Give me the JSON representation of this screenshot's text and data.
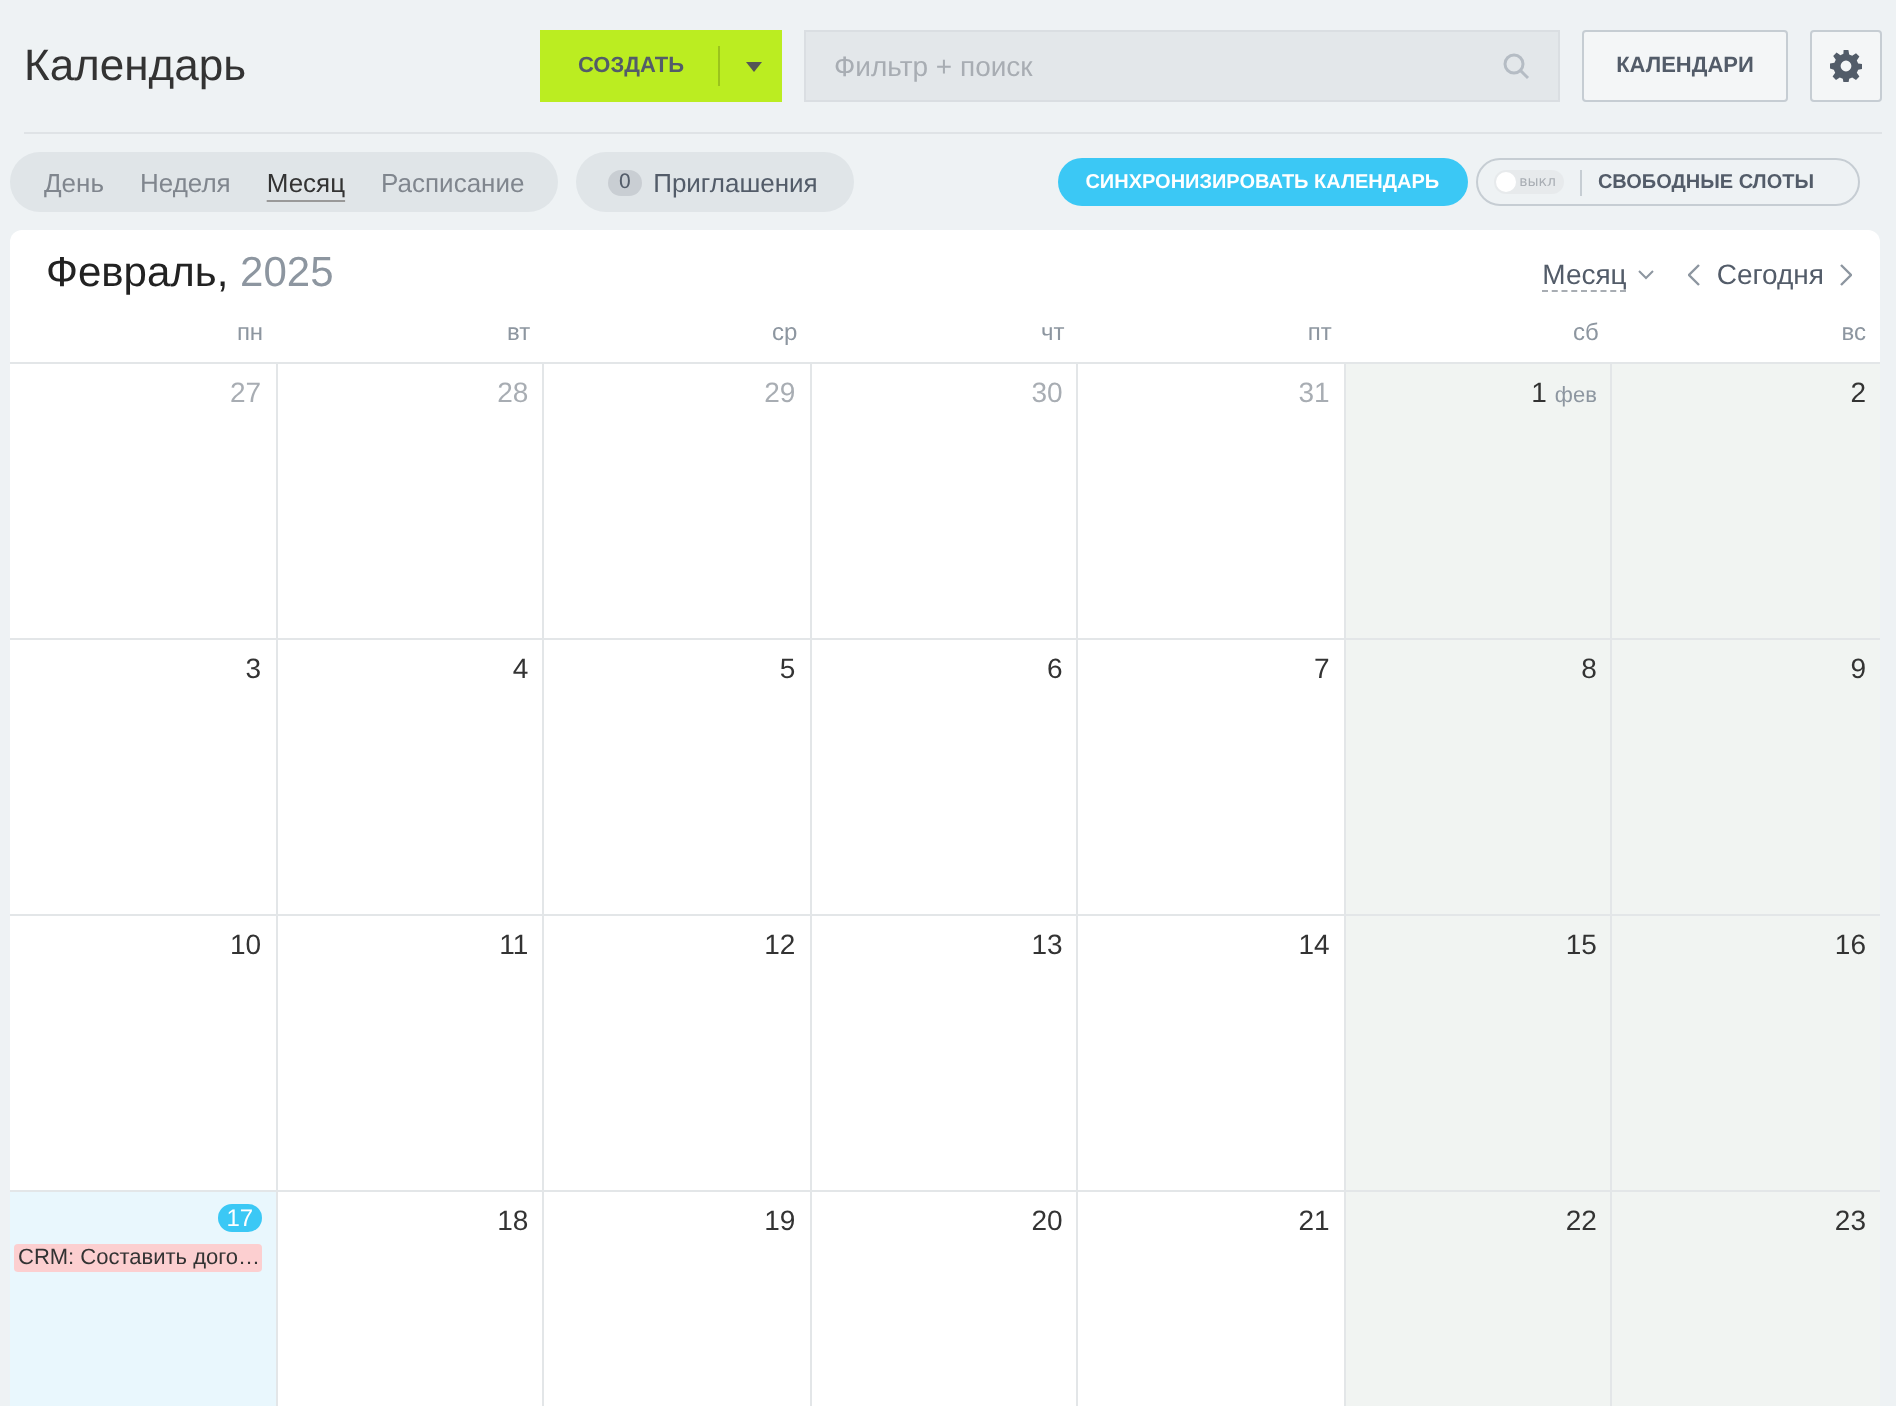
{
  "header": {
    "title": "Календарь",
    "create_button": "СОЗДАТЬ",
    "search": {
      "placeholder": "Фильтр + поиск"
    },
    "calendars_button": "КАЛЕНДАРИ"
  },
  "view_tabs": [
    {
      "label": "День",
      "selected": false
    },
    {
      "label": "Неделя",
      "selected": false
    },
    {
      "label": "Месяц",
      "selected": true
    },
    {
      "label": "Расписание",
      "selected": false
    }
  ],
  "invitations": {
    "count": "0",
    "label": "Приглашения"
  },
  "sync_button": "СИНХРОНИЗИРОВАТЬ КАЛЕНДАРЬ",
  "free_slots": {
    "toggle_label": "выкл",
    "on": false,
    "label": "СВОБОДНЫЕ СЛОТЫ"
  },
  "calendar": {
    "month": "Февраль,",
    "year": "2025",
    "view_select": "Месяц",
    "today_button": "Сегодня",
    "weekdays": [
      "пн",
      "вт",
      "ср",
      "чт",
      "пт",
      "сб",
      "вс"
    ],
    "weeks": [
      [
        {
          "day": "27",
          "other_month": true,
          "today": false
        },
        {
          "day": "28",
          "other_month": true,
          "today": false
        },
        {
          "day": "29",
          "other_month": true,
          "today": false
        },
        {
          "day": "30",
          "other_month": true,
          "today": false
        },
        {
          "day": "31",
          "other_month": true,
          "today": false
        },
        {
          "day": "1",
          "month_label": "фев",
          "other_month": false,
          "today": false
        },
        {
          "day": "2",
          "other_month": false,
          "today": false
        }
      ],
      [
        {
          "day": "3",
          "other_month": false,
          "today": false
        },
        {
          "day": "4",
          "other_month": false,
          "today": false
        },
        {
          "day": "5",
          "other_month": false,
          "today": false
        },
        {
          "day": "6",
          "other_month": false,
          "today": false
        },
        {
          "day": "7",
          "other_month": false,
          "today": false
        },
        {
          "day": "8",
          "other_month": false,
          "today": false
        },
        {
          "day": "9",
          "other_month": false,
          "today": false
        }
      ],
      [
        {
          "day": "10",
          "other_month": false,
          "today": false
        },
        {
          "day": "11",
          "other_month": false,
          "today": false
        },
        {
          "day": "12",
          "other_month": false,
          "today": false
        },
        {
          "day": "13",
          "other_month": false,
          "today": false
        },
        {
          "day": "14",
          "other_month": false,
          "today": false
        },
        {
          "day": "15",
          "other_month": false,
          "today": false
        },
        {
          "day": "16",
          "other_month": false,
          "today": false
        }
      ],
      [
        {
          "day": "17",
          "other_month": false,
          "today": true,
          "events": [
            {
              "title": "CRM: Составить дого…",
              "color": "#fccfd0"
            }
          ]
        },
        {
          "day": "18",
          "other_month": false,
          "today": false
        },
        {
          "day": "19",
          "other_month": false,
          "today": false
        },
        {
          "day": "20",
          "other_month": false,
          "today": false
        },
        {
          "day": "21",
          "other_month": false,
          "today": false
        },
        {
          "day": "22",
          "other_month": false,
          "today": false
        },
        {
          "day": "23",
          "other_month": false,
          "today": false
        }
      ]
    ]
  }
}
